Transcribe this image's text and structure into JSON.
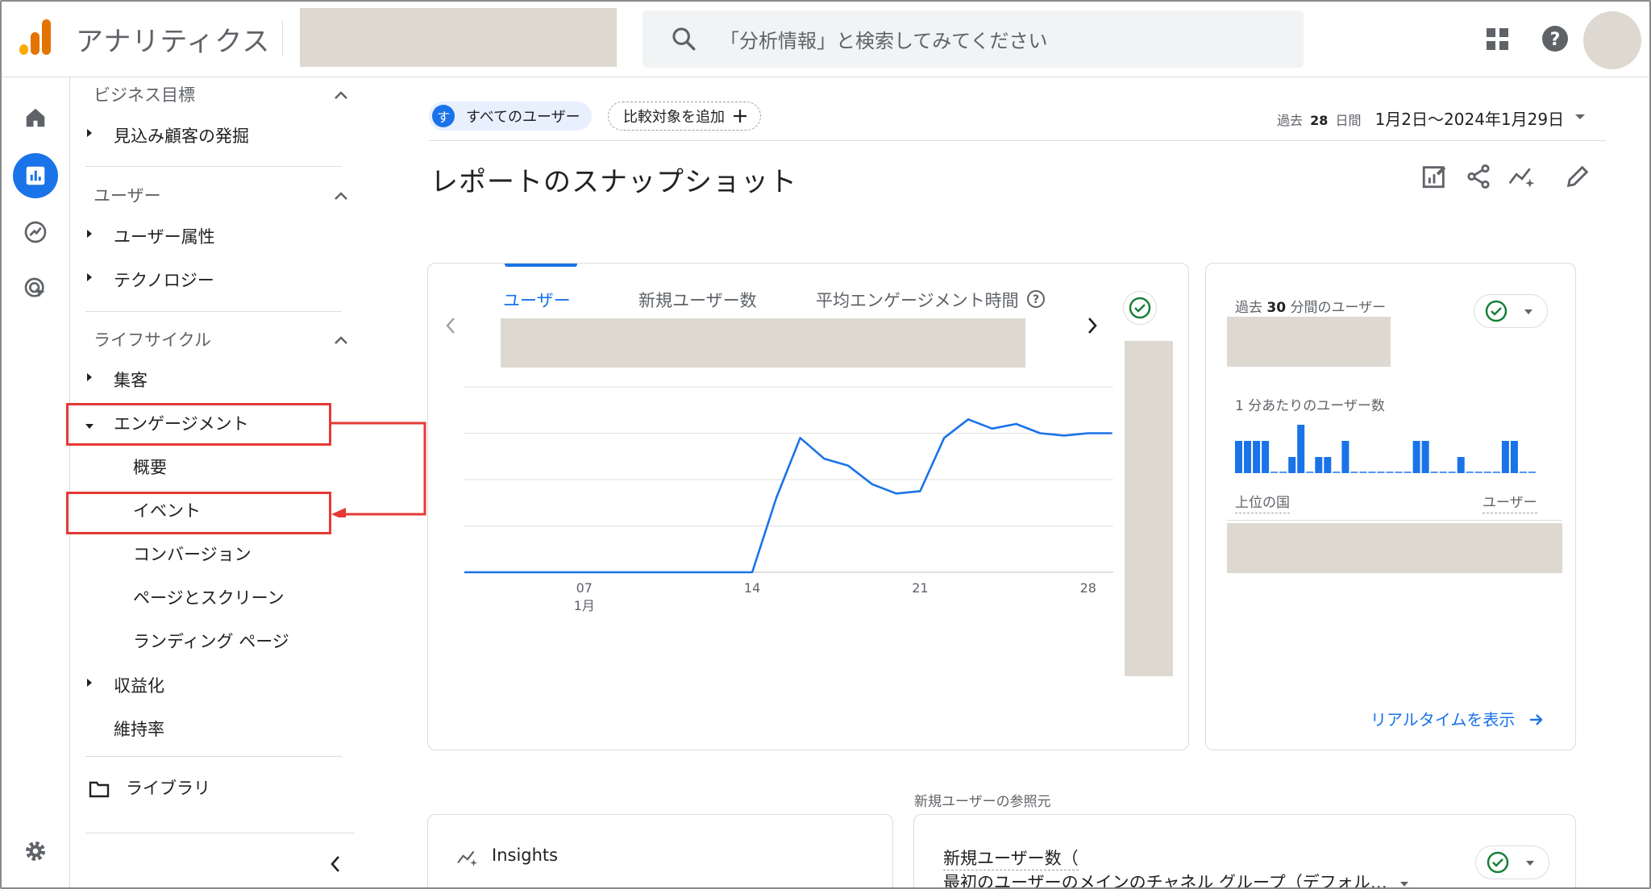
{
  "header": {
    "app_title": "アナリティクス",
    "search_placeholder": "「分析情報」と検索してみてください"
  },
  "sidebar": {
    "sections": [
      {
        "title": "ビジネス目標",
        "items": [
          {
            "label": "見込み顧客の発掘"
          }
        ]
      },
      {
        "title": "ユーザー",
        "items": [
          {
            "label": "ユーザー属性"
          },
          {
            "label": "テクノロジー"
          }
        ]
      },
      {
        "title": "ライフサイクル",
        "items": [
          {
            "label": "集客"
          },
          {
            "label": "エンゲージメント",
            "expanded": true,
            "children": [
              "概要",
              "イベント",
              "コンバージョン",
              "ページとスクリーン",
              "ランディング ページ"
            ]
          },
          {
            "label": "収益化"
          },
          {
            "label": "維持率"
          }
        ]
      }
    ],
    "library_label": "ライブラリ",
    "collapse_icon": "chevron-left-icon"
  },
  "filters": {
    "segment_badge": "す",
    "segment_label": "すべてのユーザー",
    "compare_label": "比較対象を追加",
    "date_prefix": "過去",
    "date_days": "28",
    "date_unit": "日間",
    "date_range": "1月2日〜2024年1月29日"
  },
  "page_title": "レポートのスナップショット",
  "main_card": {
    "tabs": [
      {
        "label": "ユーザー",
        "active": true
      },
      {
        "label": "新規ユーザー数",
        "active": false
      },
      {
        "label": "平均エンゲージメント時間",
        "active": false
      }
    ]
  },
  "chart_data": {
    "type": "line",
    "series": [
      {
        "values": [
          0,
          0,
          0,
          0,
          0,
          0,
          0,
          0,
          0,
          0,
          0,
          0,
          0,
          1.6,
          2.9,
          2.45,
          2.3,
          1.9,
          1.7,
          1.75,
          2.9,
          3.3,
          3.1,
          3.2,
          3.0,
          2.95,
          3.0,
          3.0
        ]
      }
    ],
    "x_tick_labels": [
      "07",
      "14",
      "21",
      "28"
    ],
    "x_tick_sublabel": "1月",
    "x_tick_days": [
      7,
      14,
      21,
      28
    ],
    "x_days_range": [
      2,
      29
    ],
    "ylim": [
      0,
      4
    ],
    "grid": true,
    "color": "#1a73e8"
  },
  "realtime_card": {
    "title_prefix": "過去",
    "title_minutes": "30",
    "title_suffix": "分間のユーザー",
    "per_minute_label": "1 分あたりのユーザー数",
    "per_minute_bars": [
      2,
      2,
      2,
      2,
      0,
      0,
      1,
      3,
      0,
      1,
      1,
      0,
      2,
      0,
      0,
      0,
      0,
      0,
      0,
      0,
      2,
      2,
      0,
      0,
      0,
      1,
      0,
      0,
      0,
      0,
      2,
      2,
      0,
      0
    ],
    "top_country_label": "上位の国",
    "users_label": "ユーザー",
    "link_label": "リアルタイムを表示"
  },
  "section_label": "新規ユーザーの参照元",
  "insights_card": {
    "label": "Insights"
  },
  "source_card": {
    "line1": "新規ユーザー数（",
    "line2": "最初のユーザーのメインのチャネル グループ（デフォル…"
  }
}
